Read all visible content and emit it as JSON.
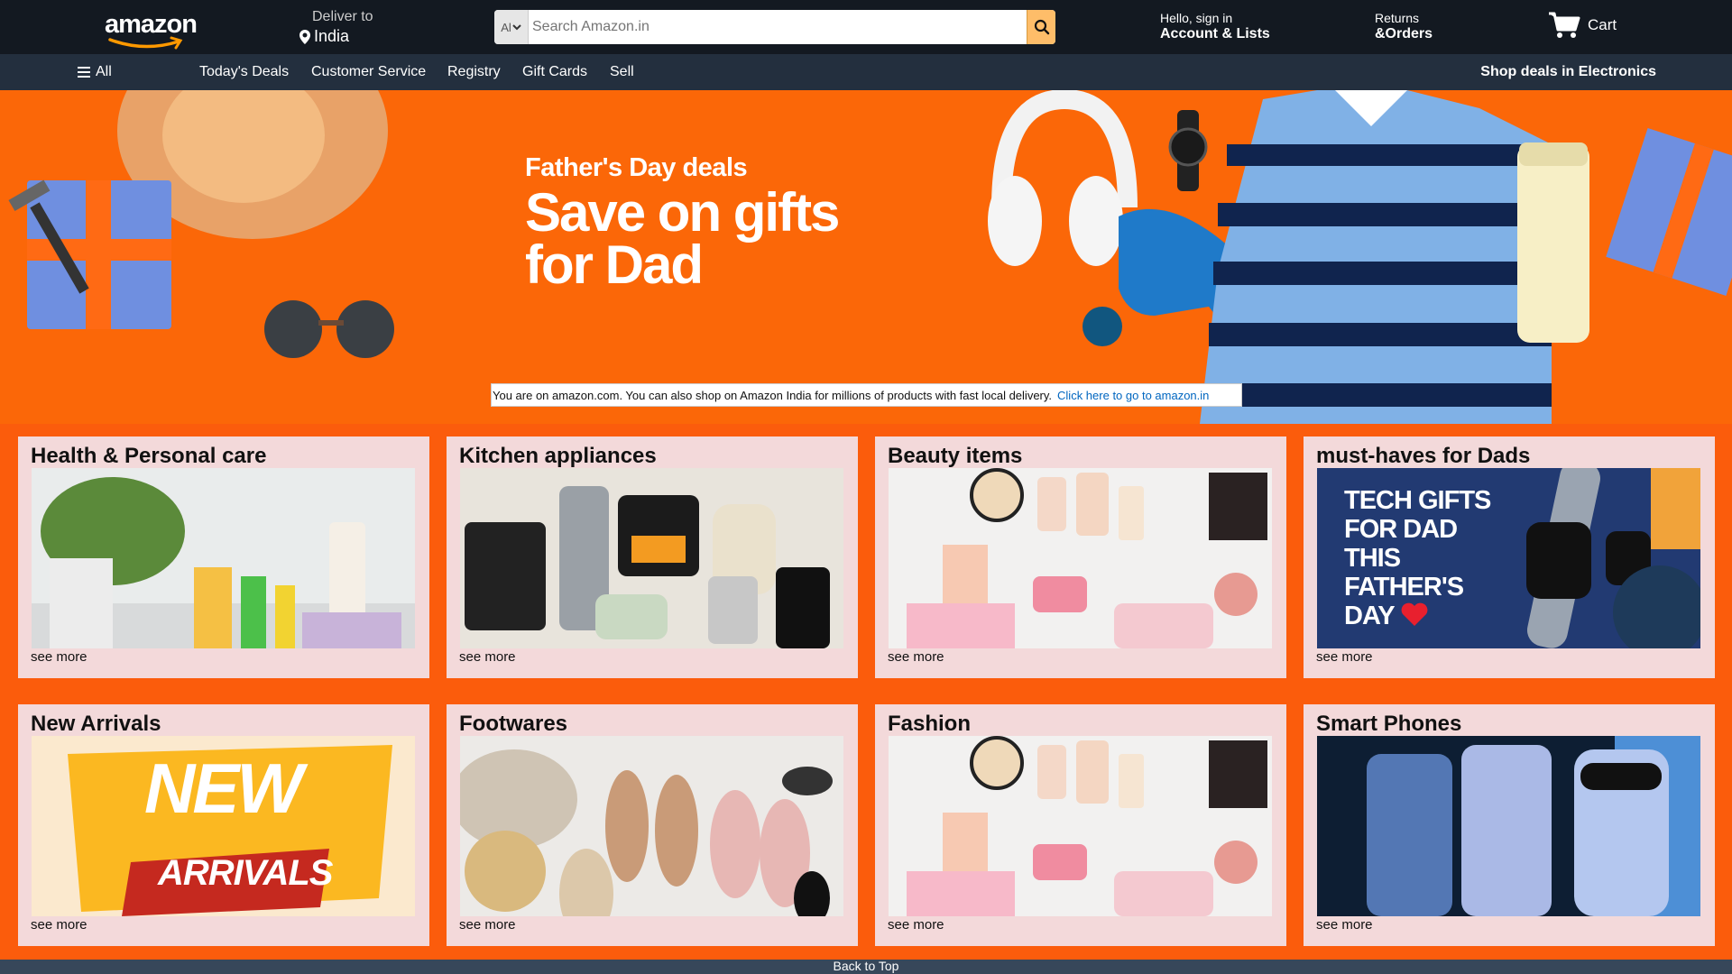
{
  "header": {
    "logo_text": "amazon",
    "deliver_line1": "Deliver to",
    "deliver_location": "India",
    "search_category": "Al",
    "search_placeholder": "Search Amazon.in",
    "account_line1": "Hello, sign in",
    "account_line2": "Account & Lists",
    "returns_line1": "Returns",
    "returns_line2": "&Orders",
    "cart_label": "Cart"
  },
  "nav": {
    "all_label": "All",
    "items": [
      "Today's Deals",
      "Customer Service",
      "Registry",
      "Gift Cards",
      "Sell"
    ],
    "promo": "Shop deals in Electronics"
  },
  "hero": {
    "kicker": "Father's Day deals",
    "title": "Save on gifts for Dad",
    "notice_text": "You are on amazon.com. You can also shop on Amazon India for millions of products with fast local delivery.",
    "notice_link": "Click here to go to amazon.in"
  },
  "cards": [
    {
      "title": "Health & Personal care",
      "link": "see more"
    },
    {
      "title": "Kitchen appliances",
      "link": "see more"
    },
    {
      "title": "Beauty items",
      "link": "see more"
    },
    {
      "title": "must-haves for Dads",
      "link": "see more",
      "image_text": "TECH GIFTS FOR DAD THIS FATHER'S DAY"
    },
    {
      "title": "New Arrivals",
      "link": "see more",
      "image_text_1": "NEW",
      "image_text_2": "ARRIVALS"
    },
    {
      "title": "Footwares",
      "link": "see more"
    },
    {
      "title": "Fashion",
      "link": "see more"
    },
    {
      "title": "Smart Phones",
      "link": "see more"
    }
  ],
  "footer": {
    "back_to_top": "Back to Top"
  },
  "colors": {
    "header_bg": "#131921",
    "nav_bg": "#232f3e",
    "page_bg": "#fb5c0c",
    "card_bg": "#f3d9da",
    "search_button": "#febd69",
    "link": "#0066c0"
  }
}
